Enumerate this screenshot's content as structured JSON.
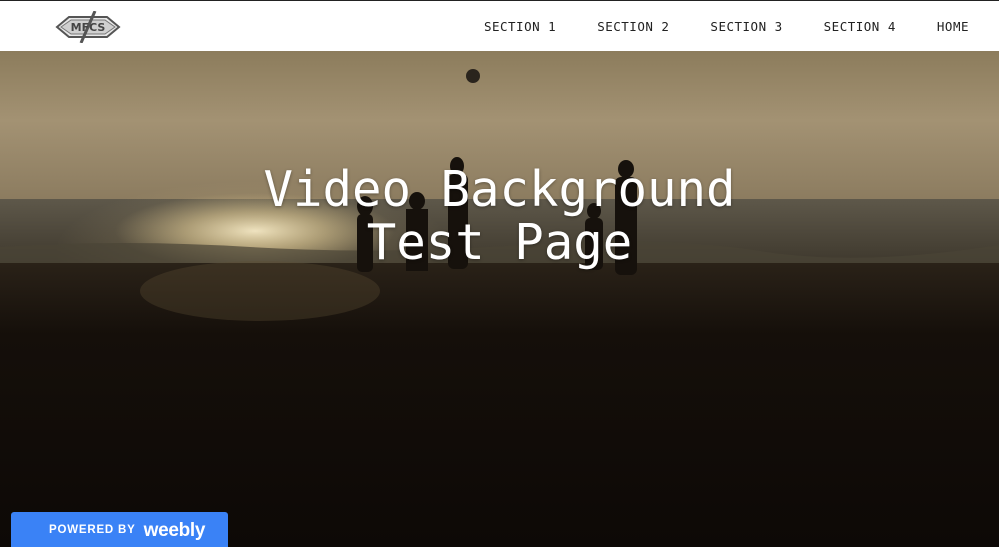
{
  "header": {
    "logo_text": "MFCS",
    "nav": [
      {
        "label": "SECTION 1"
      },
      {
        "label": "SECTION 2"
      },
      {
        "label": "SECTION 3"
      },
      {
        "label": "SECTION 4"
      },
      {
        "label": "HOME"
      }
    ]
  },
  "hero": {
    "title_line1": "Video Background",
    "title_line2": "Test Page"
  },
  "badge": {
    "powered_by": "POWERED BY",
    "brand": "weebly"
  },
  "colors": {
    "badge_blue": "#3a82f6",
    "header_bg": "#ffffff",
    "nav_text": "#222222"
  }
}
